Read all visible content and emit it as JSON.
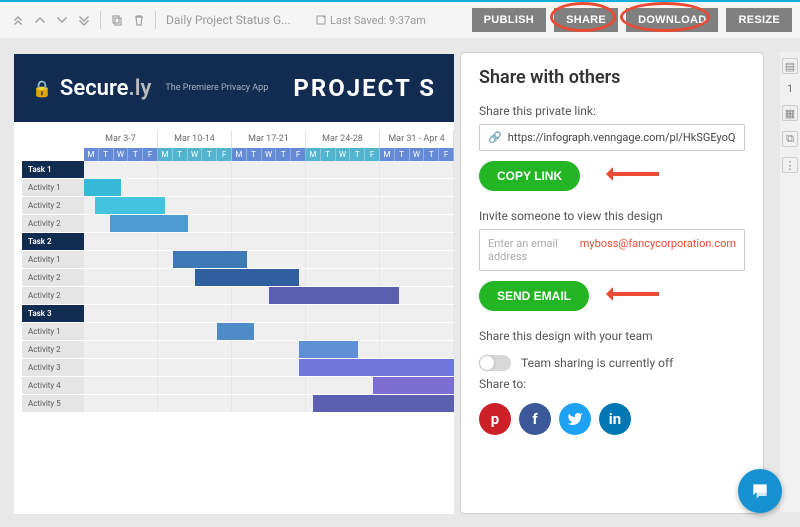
{
  "toolbar": {
    "document_title": "Daily Project Status G...",
    "last_saved_label": "Last Saved: 9:37am"
  },
  "top_buttons": {
    "publish": "PUBLISH",
    "share": "SHARE",
    "download": "DOWNLOAD",
    "resize": "RESIZE"
  },
  "document": {
    "brand_prefix": "Secure",
    "brand_suffix": ".ly",
    "brand_tagline": "The Premiere Privacy App",
    "title": "PROJECT S"
  },
  "share_panel": {
    "heading": "Share with others",
    "link_label": "Share this private link:",
    "link_value": "https://infograph.venngage.com/pl/HkSGEyoQsU",
    "copy_link": "COPY LINK",
    "invite_label": "Invite someone to view this design",
    "email_placeholder": "Enter an email address",
    "email_value": "myboss@fancycorporation.com",
    "send_email": "SEND EMAIL",
    "team_label": "Share this design with your team",
    "team_status": "Team sharing is currently off",
    "share_to": "Share to:",
    "socials": {
      "pinterest": "p",
      "facebook": "f",
      "twitter": "t",
      "linkedin": "in"
    }
  },
  "rail": {
    "page_number": "1"
  },
  "chart_data": {
    "type": "bar",
    "title": "PROJECT STATUS",
    "categories": [
      "Mar 3-7",
      "Mar 10-14",
      "Mar 17-21",
      "Mar 24-28",
      "Mar 31 - Apr 4"
    ],
    "days": [
      "M",
      "T",
      "W",
      "T",
      "F"
    ],
    "rows": [
      {
        "label": "Task 1",
        "kind": "task"
      },
      {
        "label": "Activity 1",
        "kind": "activity",
        "bars": [
          {
            "start": 0,
            "end": 10,
            "color": "#36b9d6"
          }
        ]
      },
      {
        "label": "Activity 2",
        "kind": "activity",
        "bars": [
          {
            "start": 3,
            "end": 22,
            "color": "#44c3de"
          }
        ]
      },
      {
        "label": "Activity 2",
        "kind": "activity",
        "bars": [
          {
            "start": 7,
            "end": 28,
            "color": "#4d9bd2"
          }
        ]
      },
      {
        "label": "Task 2",
        "kind": "task"
      },
      {
        "label": "Activity 1",
        "kind": "activity",
        "bars": [
          {
            "start": 24,
            "end": 44,
            "color": "#3e78b5"
          }
        ]
      },
      {
        "label": "Activity 2",
        "kind": "activity",
        "bars": [
          {
            "start": 30,
            "end": 58,
            "color": "#2f5f9e"
          }
        ]
      },
      {
        "label": "Activity 2",
        "kind": "activity",
        "bars": [
          {
            "start": 50,
            "end": 85,
            "color": "#5a5fb0"
          }
        ]
      },
      {
        "label": "Task 3",
        "kind": "task"
      },
      {
        "label": "Activity 1",
        "kind": "activity",
        "bars": [
          {
            "start": 36,
            "end": 46,
            "color": "#4f8bc6"
          }
        ]
      },
      {
        "label": "Activity 2",
        "kind": "activity",
        "bars": [
          {
            "start": 58,
            "end": 74,
            "color": "#5f8fd6"
          }
        ]
      },
      {
        "label": "Activity 3",
        "kind": "activity",
        "bars": [
          {
            "start": 58,
            "end": 100,
            "color": "#6f77d9"
          }
        ]
      },
      {
        "label": "Activity 4",
        "kind": "activity",
        "bars": [
          {
            "start": 78,
            "end": 100,
            "color": "#7a6fd1"
          }
        ]
      },
      {
        "label": "Activity 5",
        "kind": "activity",
        "bars": [
          {
            "start": 62,
            "end": 100,
            "color": "#5a5fb0"
          }
        ]
      }
    ]
  }
}
